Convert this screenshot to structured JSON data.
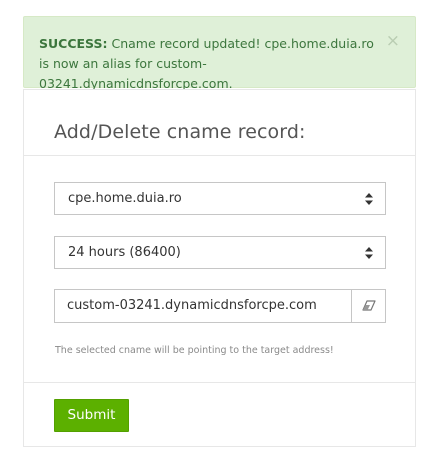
{
  "alert": {
    "label": "SUCCESS:",
    "message": "Cname record updated! cpe.home.duia.ro is now an alias for custom-03241.dynamicdnsforcpe.com.",
    "close": "×"
  },
  "form": {
    "title": "Add/Delete cname record:",
    "domain_value": "cpe.home.duia.ro",
    "ttl_value": "24 hours (86400)",
    "target_value": "custom-03241.dynamicdnsforcpe.com",
    "help_text": "The selected cname will be pointing to the target address!",
    "submit_label": "Submit"
  },
  "colors": {
    "success_bg": "#dff0d8",
    "success_text": "#3c763d",
    "button_green": "#5cb000"
  },
  "icons": {
    "select_caret": "sort-arrows-icon",
    "eraser": "eraser-icon"
  }
}
